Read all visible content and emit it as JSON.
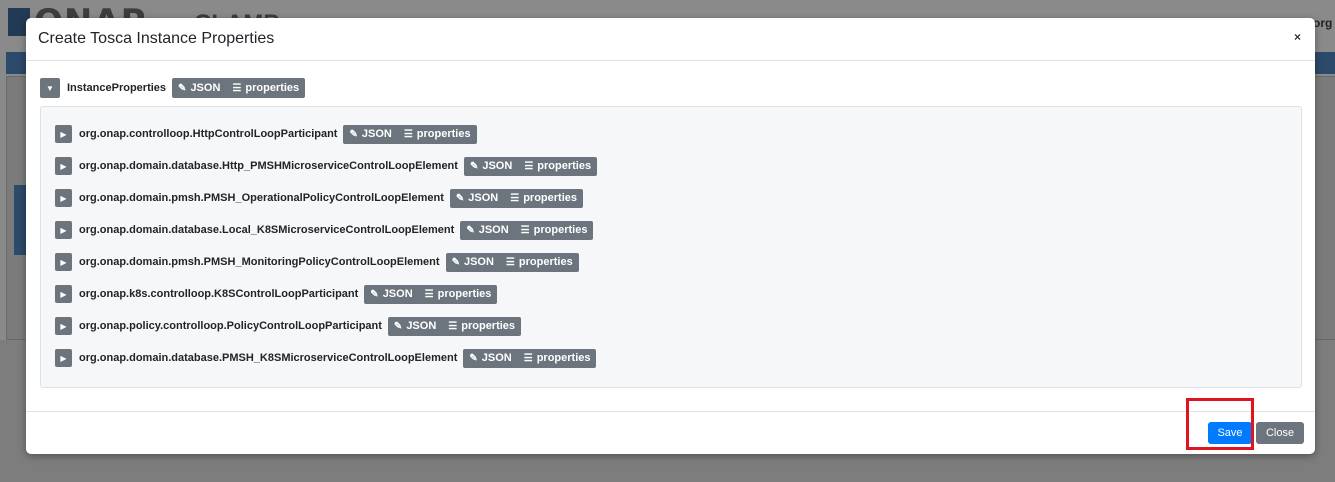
{
  "background": {
    "logo_text": "ONAP",
    "logo_suffix": "CLAMP",
    "org_text": "org"
  },
  "modal": {
    "title": "Create Tosca Instance Properties",
    "close_glyph": "×",
    "root": {
      "label": "InstanceProperties",
      "json_label": "JSON",
      "properties_label": "properties",
      "expanded": true
    },
    "children": [
      {
        "label": "org.onap.controlloop.HttpControlLoopParticipant",
        "json_label": "JSON",
        "properties_label": "properties"
      },
      {
        "label": "org.onap.domain.database.Http_PMSHMicroserviceControlLoopElement",
        "json_label": "JSON",
        "properties_label": "properties"
      },
      {
        "label": "org.onap.domain.pmsh.PMSH_OperationalPolicyControlLoopElement",
        "json_label": "JSON",
        "properties_label": "properties"
      },
      {
        "label": "org.onap.domain.database.Local_K8SMicroserviceControlLoopElement",
        "json_label": "JSON",
        "properties_label": "properties"
      },
      {
        "label": "org.onap.domain.pmsh.PMSH_MonitoringPolicyControlLoopElement",
        "json_label": "JSON",
        "properties_label": "properties"
      },
      {
        "label": "org.onap.k8s.controlloop.K8SControlLoopParticipant",
        "json_label": "JSON",
        "properties_label": "properties"
      },
      {
        "label": "org.onap.policy.controlloop.PolicyControlLoopParticipant",
        "json_label": "JSON",
        "properties_label": "properties"
      },
      {
        "label": "org.onap.domain.database.PMSH_K8SMicroserviceControlLoopElement",
        "json_label": "JSON",
        "properties_label": "properties"
      }
    ],
    "footer": {
      "save_label": "Save",
      "close_label": "Close"
    }
  },
  "icons": {
    "expand": "chevron-right-icon",
    "collapse": "chevron-down-icon",
    "edit": "pencil-icon",
    "list": "list-icon"
  },
  "colors": {
    "primary": "#007bff",
    "secondary": "#6c757d",
    "highlight": "#e0141e"
  }
}
